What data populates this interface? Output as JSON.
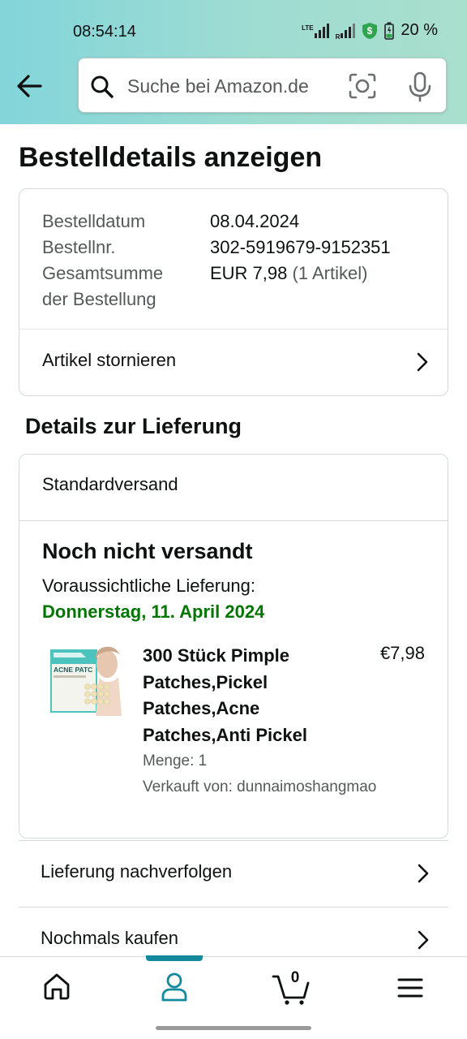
{
  "status_bar": {
    "time": "08:54:14",
    "network_tag": "LTE",
    "roaming_tag": "R",
    "battery_percent": "20 %"
  },
  "search": {
    "placeholder": "Suche bei Amazon.de"
  },
  "page": {
    "title": "Bestelldetails anzeigen"
  },
  "order": {
    "date_label": "Bestelldatum",
    "date_value": "08.04.2024",
    "number_label": "Bestellnr.",
    "number_value": "302-5919679-9152351",
    "total_label_line1": "Gesamtsumme",
    "total_label_line2": "der Bestellung",
    "total_value": "EUR 7,98",
    "total_items": "(1 Artikel)",
    "cancel_label": "Artikel stornieren"
  },
  "delivery": {
    "section_title": "Details zur Lieferung",
    "method": "Standardversand",
    "status": "Noch nicht versandt",
    "eta_label": "Voraussichtliche Lieferung:",
    "eta_date": "Donnerstag, 11. April 2024",
    "eta_color": "#007600"
  },
  "product": {
    "title": "300 Stück Pimple Patches,Pickel Patches,Acne Patches,Anti Pickel",
    "price": "€7,98",
    "quantity": "Menge: 1",
    "seller": "Verkauft von: dunnaimoshangmao",
    "image_text": "ACNE PATC"
  },
  "actions": {
    "track": "Lieferung nachverfolgen",
    "buy_again": "Nochmals kaufen"
  },
  "bottom_nav": {
    "items": [
      "home-icon",
      "account-icon",
      "cart-icon",
      "menu-icon"
    ],
    "active": "account-icon",
    "cart_count": "0",
    "accent_color": "#138a9c"
  }
}
